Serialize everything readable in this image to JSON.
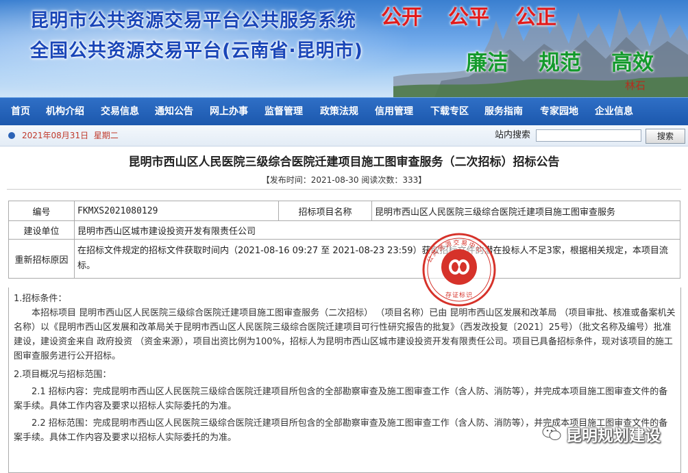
{
  "banner": {
    "title_line1": "昆明市公共资源交易平台公共服务系统",
    "title_line2": "全国公共资源交易平台(云南省·昆明市)",
    "slogan_top": [
      "公开",
      "公平",
      "公正"
    ],
    "slogan_bottom": [
      "廉洁",
      "规范",
      "高效"
    ],
    "stamp_text": "林石"
  },
  "nav": {
    "items": [
      "首页",
      "机构介绍",
      "交易信息",
      "通知公告",
      "网上办事",
      "监督管理",
      "政策法规",
      "信用管理",
      "下载专区",
      "服务指南",
      "专家园地",
      "企业信息"
    ]
  },
  "subbar": {
    "date": "2021年08月31日",
    "weekday": "星期二",
    "search_label": "站内搜索",
    "search_value": "",
    "search_button": "搜索"
  },
  "article": {
    "title": "昆明市西山区人民医院三级综合医院迁建项目施工图审查服务（二次招标）招标公告",
    "meta": "【发布时间：2021-08-30 阅读次数：333】",
    "table": {
      "row1": {
        "label1": "编号",
        "value1": "FKMXS2021080129",
        "label2": "招标项目名称",
        "value2": "昆明市西山区人民医院三级综合医院迁建项目施工图审查服务"
      },
      "row2": {
        "label": "建设单位",
        "value": "昆明市西山区城市建设投资开发有限责任公司"
      },
      "row3": {
        "label": "重新招标原因",
        "value": "在招标文件规定的招标文件获取时间内（2021-08-16 09:27 至 2021-08-23 23:59）获取招标文件的潜在投标人不足3家，根据相关规定，本项目流标。"
      }
    },
    "sections": {
      "s1_heading": "1.招标条件：",
      "s1_body": "本招标项目 昆明市西山区人民医院三级综合医院迁建项目施工图审查服务（二次招标） （项目名称）已由 昆明市西山区发展和改革局 （项目审批、核准或备案机关名称）以《昆明市西山区发展和改革局关于昆明市西山区人民医院三级综合医院迁建项目可行性研究报告的批复》（西发改投复〔2021〕25号）（批文名称及编号）批准建设，建设资金来自 政府投资 （资金来源），项目出资比例为100%，招标人为昆明市西山区城市建设投资开发有限责任公司。项目已具备招标条件，现对该项目的施工图审查服务进行公开招标。",
      "s2_heading": "2.项目概况与招标范围：",
      "s2_1": "2.1 招标内容：完成昆明市西山区人民医院三级综合医院迁建项目所包含的全部勘察审查及施工图审查工作（含人防、消防等），并完成本项目施工图审查文件的备案手续。具体工作内容及要求以招标人实际委托的为准。",
      "s2_2": "2.2 招标范围：完成昆明市西山区人民医院三级综合医院迁建项目所包含的全部勘察审查及施工图审查工作（含人防、消防等），并完成本项目施工图审查文件的备案手续。具体工作内容及要求以招标人实际委托的为准。"
    },
    "stamp": {
      "ring_text": "公共资源交易中心",
      "bottom_text": "存证标识"
    }
  },
  "watermark": {
    "text": "昆明规划建设"
  },
  "colors": {
    "nav_bg": "#1c58ad",
    "banner_title": "#1a46b8",
    "slogan_red": "#e21c1c",
    "slogan_green": "#149a2c",
    "date_red": "#c0392b",
    "stamp_red": "#d6322a"
  }
}
